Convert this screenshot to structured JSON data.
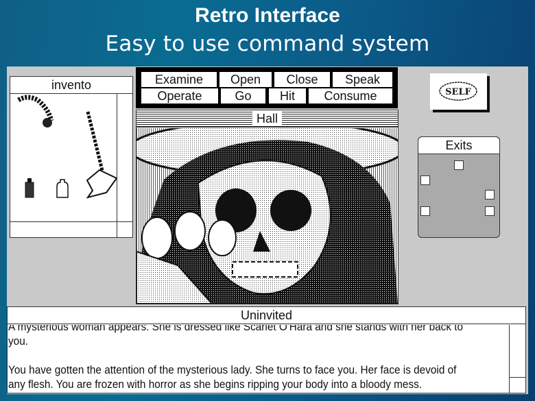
{
  "slide": {
    "title": "Retro Interface",
    "subtitle": "Easy to use command system"
  },
  "inventory": {
    "title": "invento",
    "items": [
      "rope-icon",
      "axe-icon",
      "bottle-icon",
      "jar-icon"
    ]
  },
  "commands": [
    {
      "label": "Examine"
    },
    {
      "label": "Open"
    },
    {
      "label": "Close"
    },
    {
      "label": "Speak"
    },
    {
      "label": "Operate"
    },
    {
      "label": "Go"
    },
    {
      "label": "Hit"
    },
    {
      "label": "Consume"
    }
  ],
  "scene": {
    "title": "Hall"
  },
  "self_button": {
    "label": "SELF"
  },
  "exits": {
    "title": "Exits"
  },
  "message": {
    "title": "Uninvited",
    "paragraphs": [
      "A mysterious woman appears. She is dressed like Scarlet O'Hara and she stands with her back to you.",
      "You have gotten the attention of the mysterious lady. She turns to face you. Her face is devoid of any flesh. You are frozen with horror as she begins ripping your body into a bloody mess."
    ]
  }
}
